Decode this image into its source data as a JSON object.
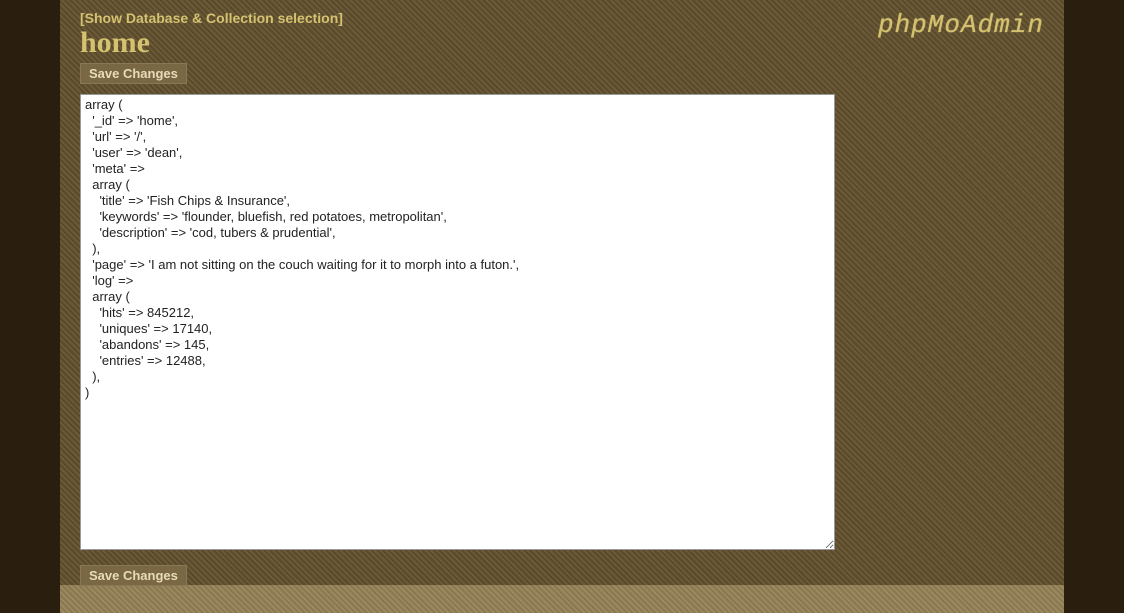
{
  "header": {
    "show_selection_link": "[Show Database & Collection selection]",
    "title": "home",
    "logo": "phpMoAdmin"
  },
  "buttons": {
    "save_top": "Save Changes",
    "save_bottom": "Save Changes"
  },
  "editor": {
    "content": "array (\n  '_id' => 'home',\n  'url' => '/',\n  'user' => 'dean',\n  'meta' => \n  array (\n    'title' => 'Fish Chips & Insurance',\n    'keywords' => 'flounder, bluefish, red potatoes, metropolitan',\n    'description' => 'cod, tubers & prudential',\n  ),\n  'page' => 'I am not sitting on the couch waiting for it to morph into a futon.',\n  'log' => \n  array (\n    'hits' => 845212,\n    'uniques' => 17140,\n    'abandons' => 145,\n    'entries' => 12488,\n  ),\n)"
  }
}
